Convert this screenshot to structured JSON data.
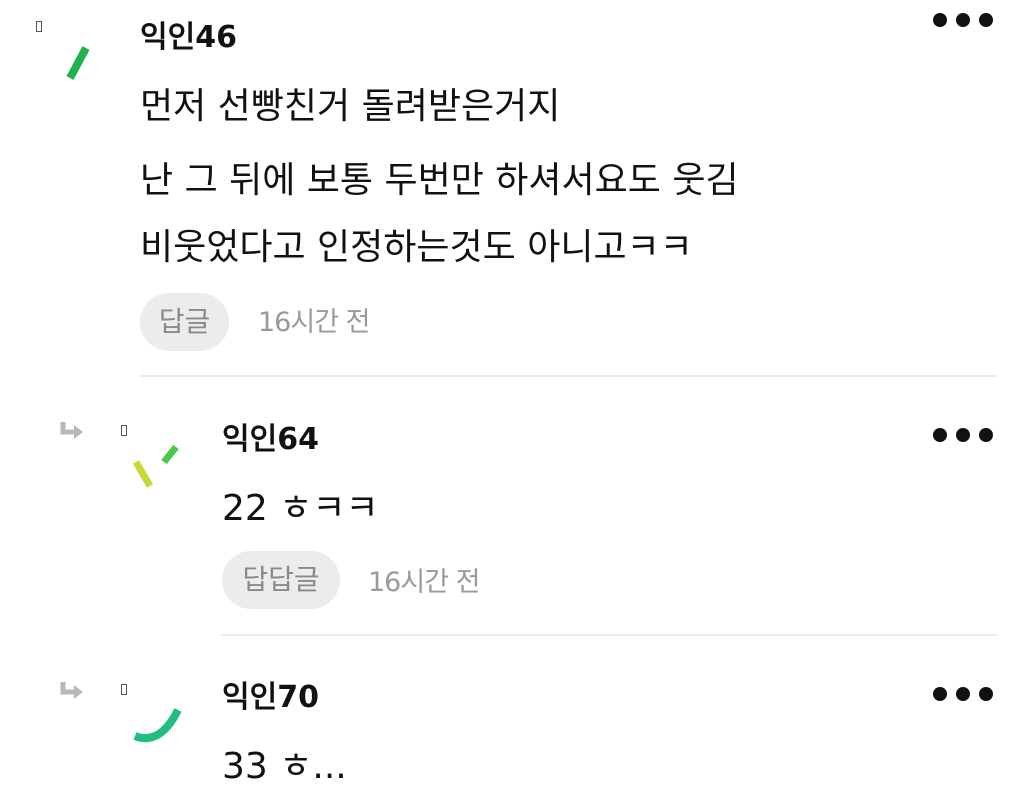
{
  "comments": [
    {
      "author": "익인46",
      "lines": [
        "먼저 선빵친거 돌려받은거지",
        "난 그 뒤에 보통 두번만 하셔서요도 웃김",
        "비웃었다고 인정하는것도 아니고ㅋㅋ"
      ],
      "reply_label": "답글",
      "time": "16시간 전",
      "avatar_icon": "green-dash-icon",
      "avatar_color": "#22b24c"
    },
    {
      "author": "익인64",
      "lines": [
        "22 ㅎㅋㅋ"
      ],
      "reply_label": "답답글",
      "time": "16시간 전",
      "avatar_icon": "confetti-icon",
      "avatar_colors": [
        "#c9d93a",
        "#4cc94c"
      ]
    },
    {
      "author": "익인70",
      "lines": [
        "33 ㅎ..."
      ],
      "avatar_icon": "arc-icon",
      "avatar_color": "#1fbf7f"
    }
  ],
  "icons": {
    "more": "more-dots-icon",
    "reply_arrow": "reply-arrow-icon"
  }
}
